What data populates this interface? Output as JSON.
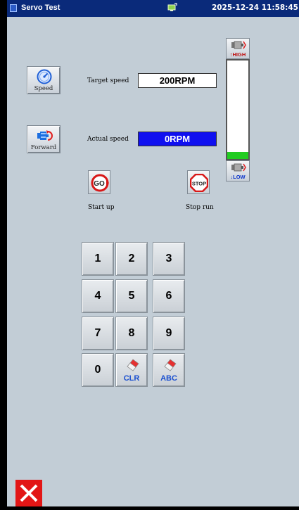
{
  "titlebar": {
    "app_title": "Servo Test",
    "datetime": "2025-12-24 11:58:45"
  },
  "controls": {
    "speed_label": "Speed",
    "forward_label": "Forward"
  },
  "readouts": {
    "target_label": "Target speed",
    "target_value": "200RPM",
    "actual_label": "Actual speed",
    "actual_value": "0RPM",
    "actual_bg_color": "#1010f0"
  },
  "gauge": {
    "high_label": "HIGH",
    "low_label": "LOW",
    "level_fraction": 0.07,
    "fill_color": "#22cc22"
  },
  "actions": {
    "start_label": "Start up",
    "stop_label": "Stop run",
    "go_text": "GO",
    "stop_text": "STOP"
  },
  "keypad": {
    "keys": [
      "1",
      "2",
      "3",
      "4",
      "5",
      "6",
      "7",
      "8",
      "9",
      "0"
    ],
    "clr_label": "CLR",
    "abc_label": "ABC"
  },
  "icons": [
    "speedometer-icon",
    "motor-forward-icon",
    "high-speed-icon",
    "low-speed-icon",
    "go-icon",
    "stop-icon",
    "eraser-icon",
    "close-icon"
  ]
}
